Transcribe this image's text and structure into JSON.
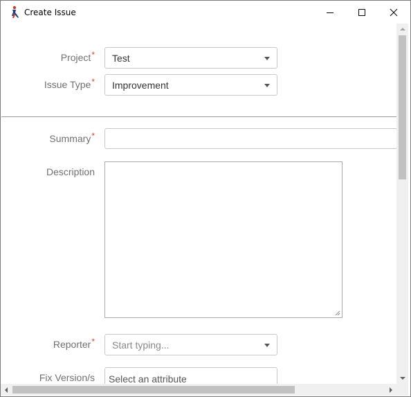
{
  "window": {
    "title": "Create Issue",
    "app_icon": "jira-figure-icon"
  },
  "form": {
    "project": {
      "label": "Project",
      "required_mark": "*",
      "value": "Test"
    },
    "issue_type": {
      "label": "Issue Type",
      "required_mark": "*",
      "value": "Improvement"
    },
    "summary": {
      "label": "Summary",
      "required_mark": "*",
      "value": ""
    },
    "description": {
      "label": "Description",
      "value": ""
    },
    "reporter": {
      "label": "Reporter",
      "required_mark": "*",
      "placeholder": "Start typing..."
    },
    "fix_versions": {
      "label": "Fix Version/s",
      "placeholder": "Select an attribute"
    }
  },
  "colors": {
    "required": "#d04437",
    "label": "#707070"
  }
}
